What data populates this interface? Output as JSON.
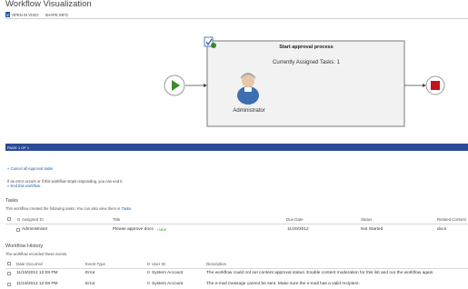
{
  "page": {
    "title": "Workflow Visualization"
  },
  "toolbar": {
    "open_in_visio": "OPEN IN VISIO",
    "shape_info": "SHAPE INFO"
  },
  "diagram": {
    "task_title": "Start approval process",
    "assigned_tasks": "Currently Assigned Tasks: 1",
    "assignee": "Administrator"
  },
  "pager": {
    "label": "PAGE 1 OF 1"
  },
  "actions": {
    "cancel_all": "» Cancel all Approval tasks",
    "error_hint": "If an error occurs or if this workflow stops responding, you can end it.",
    "end_workflow": "» End this workflow."
  },
  "tasks": {
    "heading": "Tasks",
    "description_prefix": "This workflow created the following tasks. You can also view them in ",
    "description_link": "Tasks",
    "description_suffix": ".",
    "columns": [
      "Assigned To",
      "Title",
      "Due Date",
      "Status",
      "Related Content"
    ],
    "rows": [
      {
        "assigned_to": "Administrator",
        "title": "Please approve docs",
        "new_badge": "! NEW",
        "due_date": "11/20/2012",
        "status": "Not Started",
        "related": "docs"
      }
    ]
  },
  "history": {
    "heading": "Workflow History",
    "description": "The workflow recorded these events.",
    "columns": [
      "Date Occurred",
      "Event Type",
      "User ID",
      "Description"
    ],
    "rows": [
      {
        "date": "11/19/2012 12:08 PM",
        "event": "Error",
        "user": "System Account",
        "description": "The workflow could not set content approval status. Enable content moderation for this list and run the workflow again."
      },
      {
        "date": "11/19/2012 12:08 PM",
        "event": "Error",
        "user": "System Account",
        "description": "The e-mail message cannot be sent. Make sure the e-mail has a valid recipient."
      }
    ]
  },
  "colors": {
    "accent": "#2a4b96",
    "link": "#1f5ea6",
    "start": "#3a8a2a",
    "end": "#c4121b"
  }
}
